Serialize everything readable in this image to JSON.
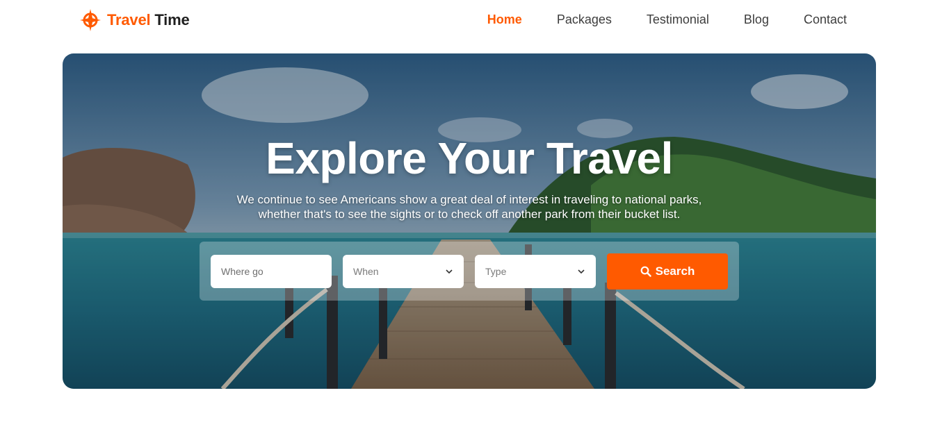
{
  "brand": {
    "name_part1": "Travel",
    "name_part2": "Time",
    "accent_color": "#ff5a00"
  },
  "nav": {
    "items": [
      {
        "label": "Home",
        "active": true
      },
      {
        "label": "Packages",
        "active": false
      },
      {
        "label": "Testimonial",
        "active": false
      },
      {
        "label": "Blog",
        "active": false
      },
      {
        "label": "Contact",
        "active": false
      }
    ]
  },
  "hero": {
    "title": "Explore Your Travel",
    "text": "We continue to see Americans show a great deal of interest in traveling to national parks, whether that's to see the sights or to check off another park from their bucket list.",
    "background": "tropical-pier-photo"
  },
  "search": {
    "where_placeholder": "Where go",
    "when_value": "When",
    "type_value": "Type",
    "button_label": "Search",
    "button_icon": "search-icon"
  }
}
